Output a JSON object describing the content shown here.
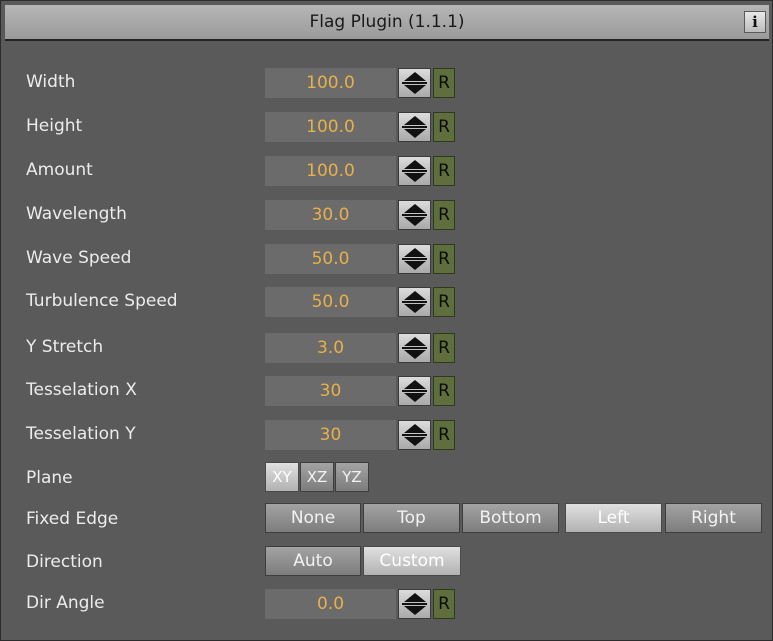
{
  "header": {
    "title": "Flag Plugin (1.1.1)",
    "info_glyph": "i"
  },
  "params": [
    {
      "label": "Width",
      "value": "100.0"
    },
    {
      "label": "Height",
      "value": "100.0"
    },
    {
      "label": "Amount",
      "value": "100.0"
    },
    {
      "label": "Wavelength",
      "value": "30.0"
    },
    {
      "label": "Wave Speed",
      "value": "50.0"
    },
    {
      "label": "Turbulence Speed",
      "value": "50.0"
    },
    {
      "label": "Y Stretch",
      "value": "3.0"
    },
    {
      "label": "Tesselation X",
      "value": "30"
    },
    {
      "label": "Tesselation Y",
      "value": "30"
    }
  ],
  "reset_label": "R",
  "plane": {
    "label": "Plane",
    "options": [
      "XY",
      "XZ",
      "YZ"
    ],
    "selected": "XY"
  },
  "fixed_edge": {
    "label": "Fixed Edge",
    "options": [
      "None",
      "Top",
      "Bottom",
      "Left",
      "Right"
    ],
    "selected": "Left"
  },
  "direction": {
    "label": "Direction",
    "options": [
      "Auto",
      "Custom"
    ],
    "selected": "Custom"
  },
  "dir_angle": {
    "label": "Dir Angle",
    "value": "0.0"
  },
  "colors": {
    "value_text": "#e8b04a",
    "reset_button": "#5e6f3d",
    "panel_bg": "#5a5a5a"
  }
}
